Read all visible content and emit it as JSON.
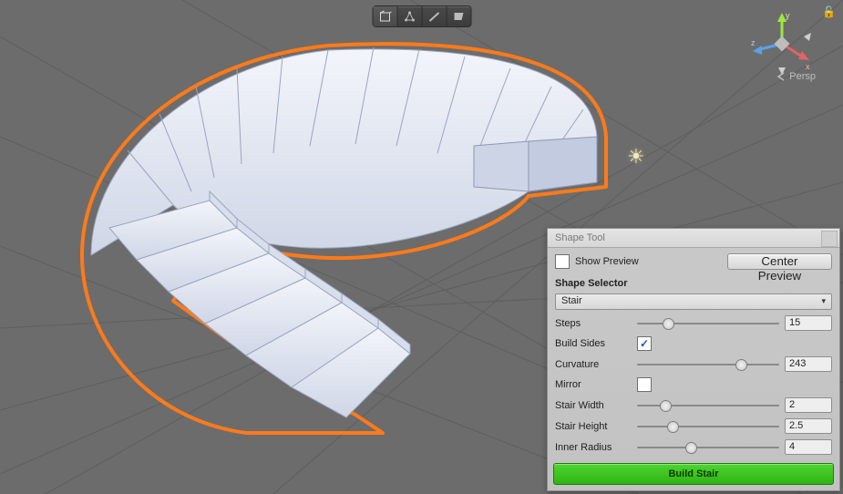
{
  "toolbar": {
    "buttons": [
      "cube-icon",
      "pivot-icon",
      "edge-icon",
      "flag-icon"
    ],
    "activeIndex": 0
  },
  "gizmo": {
    "x_label": "x",
    "y_label": "y",
    "z_label": "z",
    "persp_label": "Persp"
  },
  "lock_icon": "🔓",
  "sun_icon": "☀",
  "panel": {
    "title": "Shape Tool",
    "show_preview_label": "Show Preview",
    "show_preview_checked": false,
    "center_preview_label": "Center Preview",
    "shape_selector_label": "Shape Selector",
    "shape_value": "Stair",
    "fields": {
      "steps": {
        "label": "Steps",
        "value": "15",
        "thumb": 22
      },
      "build_sides": {
        "label": "Build Sides",
        "checked": true
      },
      "curvature": {
        "label": "Curvature",
        "value": "243",
        "thumb": 73
      },
      "mirror": {
        "label": "Mirror",
        "checked": false
      },
      "stair_width": {
        "label": "Stair Width",
        "value": "2",
        "thumb": 20
      },
      "stair_height": {
        "label": "Stair Height",
        "value": "2.5",
        "thumb": 25
      },
      "inner_radius": {
        "label": "Inner Radius",
        "value": "4",
        "thumb": 38
      }
    },
    "build_label": "Build Stair"
  }
}
